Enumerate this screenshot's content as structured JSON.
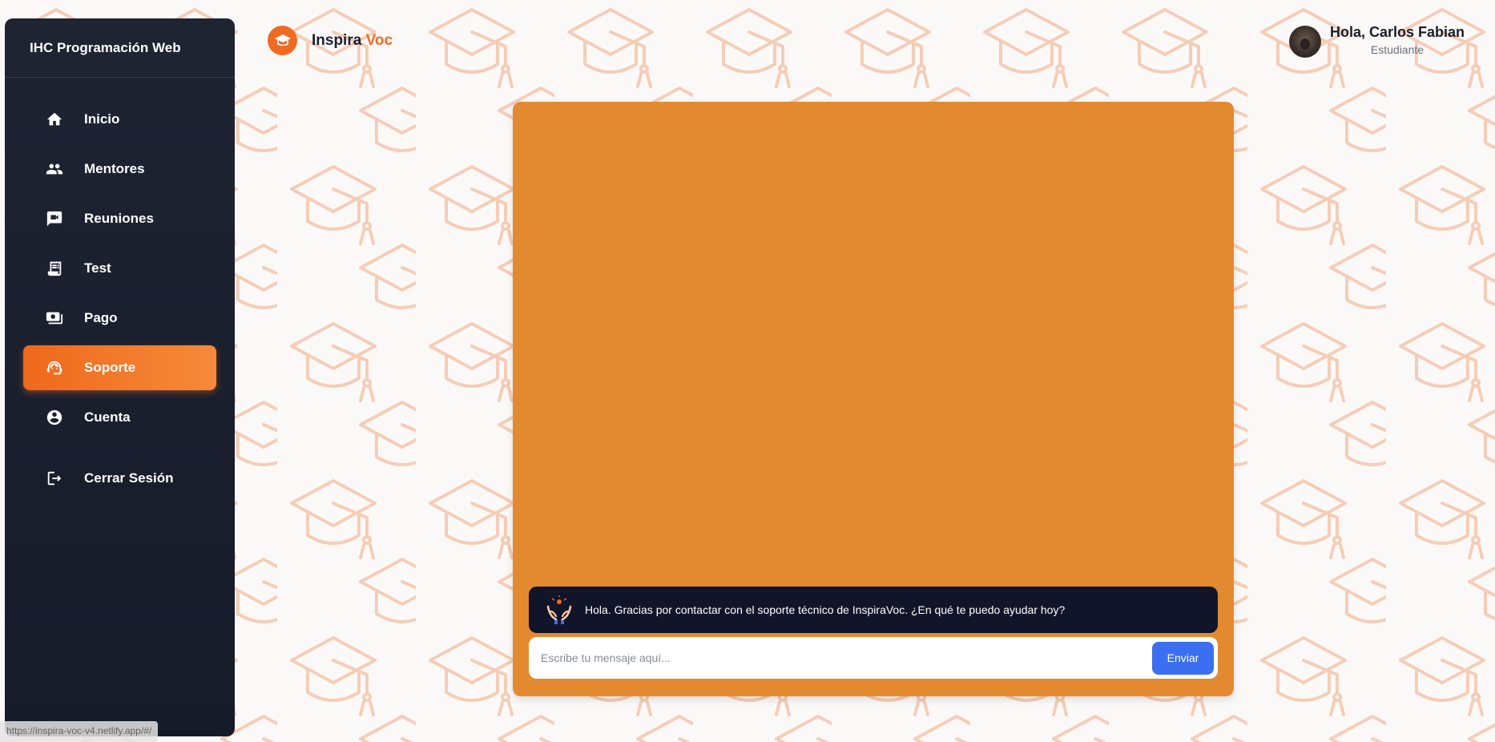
{
  "sidebar": {
    "title": "IHC Programación Web",
    "items": [
      {
        "label": "Inicio",
        "icon": "home-icon"
      },
      {
        "label": "Mentores",
        "icon": "people-icon"
      },
      {
        "label": "Reuniones",
        "icon": "video-chat-icon"
      },
      {
        "label": "Test",
        "icon": "receipt-icon"
      },
      {
        "label": "Pago",
        "icon": "payment-icon"
      },
      {
        "label": "Soporte",
        "icon": "support-agent-icon",
        "active": true
      },
      {
        "label": "Cuenta",
        "icon": "account-circle-icon"
      }
    ],
    "logout_label": "Cerrar Sesión"
  },
  "header": {
    "brand_part1": "Inspira",
    "brand_part2": "Voc",
    "greeting": "Hola, Carlos Fabian",
    "role": "Estudiante"
  },
  "chat": {
    "bot_message": "Hola. Gracias por contactar con el soporte técnico de InspiraVoc. ¿En qué te puedo ayudar hoy?",
    "input_placeholder": "Escribe tu mensaje aquí...",
    "input_value": "",
    "send_label": "Enviar"
  },
  "status_bar": {
    "url": "https://inspira-voc-v4.netlify.app/#/"
  },
  "colors": {
    "sidebar_bg": "#1f2433",
    "accent_orange": "#f16b1e",
    "chat_panel": "#e38a30",
    "message_bg": "#12142a",
    "send_button": "#3b6ff0"
  }
}
